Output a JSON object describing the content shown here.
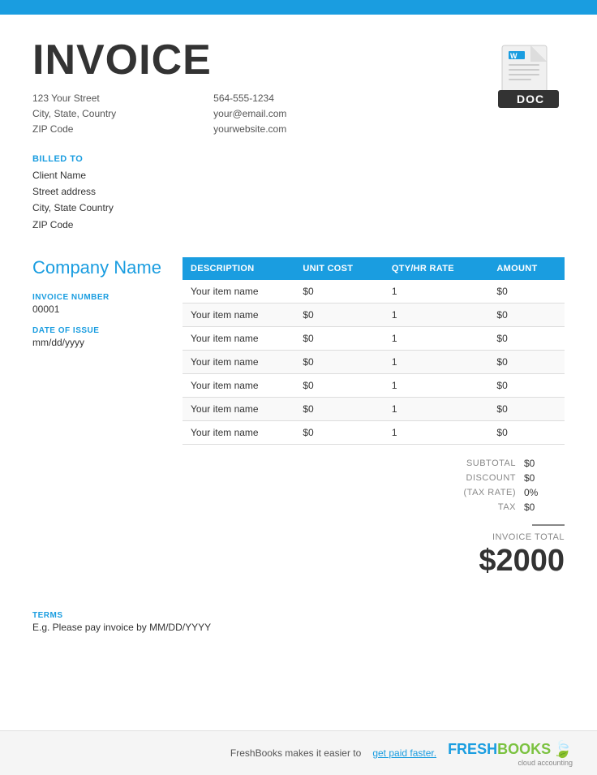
{
  "topBar": {
    "color": "#1a9de0"
  },
  "header": {
    "title": "INVOICE",
    "address_line1": "123 Your Street",
    "address_line2": "City, State, Country",
    "address_line3": "ZIP Code",
    "phone": "564-555-1234",
    "email": "your@email.com",
    "website": "yourwebsite.com"
  },
  "billedTo": {
    "label": "BILLED TO",
    "client_name": "Client Name",
    "street": "Street address",
    "city_state": "City, State Country",
    "zip": "ZIP Code"
  },
  "leftPanel": {
    "company_name": "Company Name",
    "invoice_number_label": "INVOICE NUMBER",
    "invoice_number": "00001",
    "date_of_issue_label": "DATE OF ISSUE",
    "date_of_issue": "mm/dd/yyyy"
  },
  "table": {
    "headers": [
      "DESCRIPTION",
      "UNIT COST",
      "QTY/HR RATE",
      "AMOUNT"
    ],
    "rows": [
      {
        "description": "Your item name",
        "unit_cost": "$0",
        "qty": "1",
        "amount": "$0"
      },
      {
        "description": "Your item name",
        "unit_cost": "$0",
        "qty": "1",
        "amount": "$0"
      },
      {
        "description": "Your item name",
        "unit_cost": "$0",
        "qty": "1",
        "amount": "$0"
      },
      {
        "description": "Your item name",
        "unit_cost": "$0",
        "qty": "1",
        "amount": "$0"
      },
      {
        "description": "Your item name",
        "unit_cost": "$0",
        "qty": "1",
        "amount": "$0"
      },
      {
        "description": "Your item name",
        "unit_cost": "$0",
        "qty": "1",
        "amount": "$0"
      },
      {
        "description": "Your item name",
        "unit_cost": "$0",
        "qty": "1",
        "amount": "$0"
      }
    ]
  },
  "totals": {
    "subtotal_label": "SUBTOTAL",
    "subtotal_value": "$0",
    "discount_label": "DISCOUNT",
    "discount_value": "$0",
    "tax_rate_label": "(TAX RATE)",
    "tax_rate_value": "0%",
    "tax_label": "TAX",
    "tax_value": "$0",
    "invoice_total_label": "INVOICE TOTAL",
    "invoice_total_amount": "$2000"
  },
  "terms": {
    "label": "TERMS",
    "text": "E.g. Please pay invoice by MM/DD/YYYY"
  },
  "footer": {
    "text": "FreshBooks makes it easier to",
    "link_text": "get paid faster.",
    "logo_fresh": "FRESH",
    "logo_books": "BOOKS",
    "logo_sub": "cloud accounting"
  }
}
